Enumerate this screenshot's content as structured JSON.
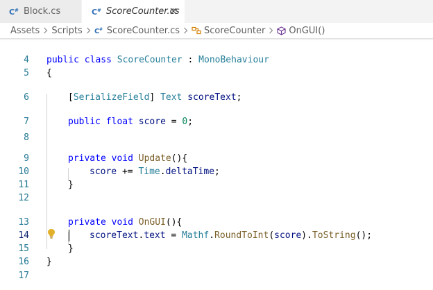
{
  "tabs": [
    {
      "label": "Block.cs",
      "active": false
    },
    {
      "label": "ScoreCounter.cs",
      "active": true
    }
  ],
  "breadcrumb": {
    "folder1": "Assets",
    "folder2": "Scripts",
    "file": "ScoreCounter.cs",
    "class": "ScoreCounter",
    "method": "OnGUI()"
  },
  "code": {
    "line_numbers": [
      "4",
      "5",
      "6",
      "7",
      "8",
      "9",
      "10",
      "11",
      "12",
      "13",
      "14",
      "15",
      "16",
      "17"
    ],
    "line4": {
      "kw_public": "public",
      "kw_class": "class",
      "class_name": "ScoreCounter",
      "colon": " : ",
      "base": "MonoBehaviour"
    },
    "line5": {
      "brace": "{"
    },
    "line6": {
      "attr_open": "[",
      "attr_name": "SerializeField",
      "attr_close": "]",
      "type": "Text",
      "field": "scoreText",
      "end": ";"
    },
    "line7": {
      "kw_public": "public",
      "kw_float": "float",
      "field": "score",
      "eq": " = ",
      "value": "0",
      "end": ";"
    },
    "line9": {
      "kw_private": "private",
      "kw_void": "void",
      "method": "Update",
      "paren": "(){"
    },
    "line10": {
      "var": "score",
      "op": " += ",
      "type": "Time",
      "dot": ".",
      "prop": "deltaTime",
      "end": ";"
    },
    "line11": {
      "brace": "}"
    },
    "line13": {
      "kw_private": "private",
      "kw_void": "void",
      "method": "OnGUI",
      "paren": "(){"
    },
    "line14": {
      "var": "scoreText",
      "dot1": ".",
      "prop": "text",
      "eq": " = ",
      "type": "Mathf",
      "dot2": ".",
      "fn1": "RoundToInt",
      "open": "(",
      "arg": "score",
      "close": ")",
      "dot3": ".",
      "fn2": "ToString",
      "end": "();"
    },
    "line15": {
      "brace": "}"
    },
    "line16": {
      "brace": "}"
    }
  },
  "colors": {
    "keyword": "#0000ff",
    "type": "#267f99",
    "function": "#795e26",
    "number": "#098658",
    "variable": "#001080",
    "line_number": "#237893",
    "csharp_icon": "#2f6fb6"
  },
  "icons": {
    "file_type": "csharp-icon",
    "close": "close-icon",
    "class_symbol": "class-symbol-icon",
    "method_symbol": "method-symbol-icon",
    "code_action": "lightbulb-icon"
  }
}
